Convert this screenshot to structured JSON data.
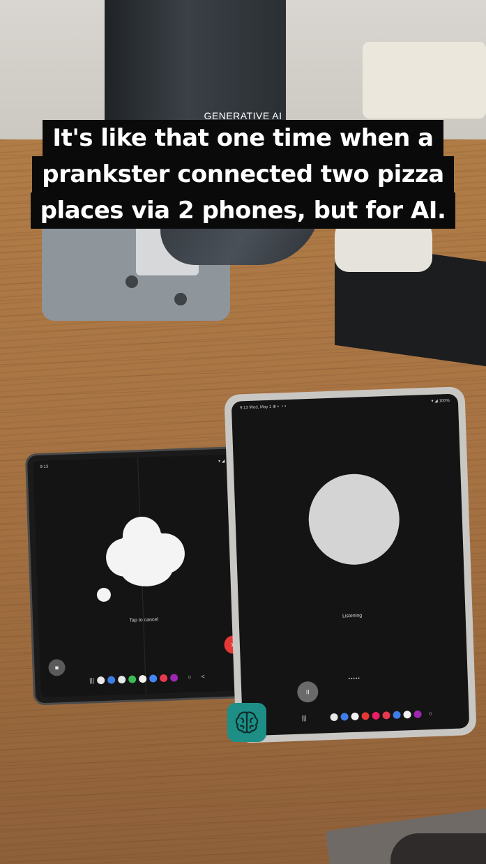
{
  "caption": {
    "tag": "GENERATIVE AI",
    "lines": [
      "It's like that one time when a",
      "prankster connected two pizza",
      "places via 2 phones, but for AI."
    ]
  },
  "foldable_phone": {
    "status_left": "9:13",
    "status_right": "▾ ◢ 100%",
    "hint_text": "Tap to cancel",
    "end_call_glyph": "×",
    "left_button_glyph": "■",
    "nav_glyphs": [
      "|||",
      "○",
      "<"
    ]
  },
  "tablet": {
    "status_left": "9:13 Wed, May 1 ⊕ ◐ ◔ •",
    "status_right": "▾ ◢ 100%",
    "state_text": "Listening",
    "progress_text": "•••••",
    "pause_glyph": "II",
    "end_call_glyph": "×",
    "nav_glyphs": [
      "|||",
      "○"
    ]
  },
  "app_logo": {
    "icon": "brain-icon",
    "color": "#1e8f86"
  },
  "colors": {
    "caption_bg": "#0a0a0a",
    "end_call_red": "#e53935",
    "end_call_orange": "#f57c1f"
  }
}
